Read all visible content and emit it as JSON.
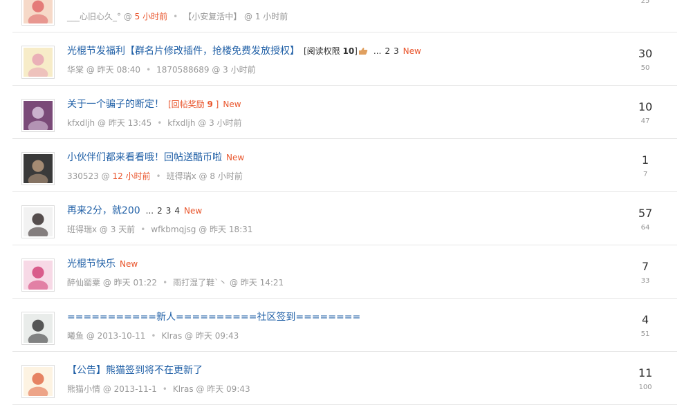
{
  "threads": [
    {
      "title": "",
      "tag": "",
      "tag_num": "",
      "has_thumb": false,
      "pages": [],
      "is_new": false,
      "author": "___心旧心久_°",
      "author_time": "5 小时前",
      "author_time_red": true,
      "last_poster": "【小安复活中】",
      "last_time": "1 小时前",
      "replies": "",
      "views": "25",
      "avatar_colors": [
        "#f6d9c8",
        "#e06a6a"
      ]
    },
    {
      "title": "光棍节发福利【群名片修改插件，抢楼免费发放授权】",
      "tag": "[阅读权限 ",
      "tag_num": "10",
      "tag_end": "]",
      "tag_dark": true,
      "has_thumb": true,
      "pages": [
        "2",
        "3"
      ],
      "is_new": true,
      "author": "华棠",
      "author_time": "昨天 08:40",
      "author_time_red": false,
      "last_poster": "1870588689",
      "last_time": "3 小时前",
      "replies": "30",
      "views": "50",
      "avatar_colors": [
        "#f7ecc8",
        "#e8a6b4"
      ]
    },
    {
      "title": "关于一个骗子的断定！",
      "tag": "[回帖奖励 ",
      "tag_num": "9",
      "tag_end": " ]",
      "tag_dark": false,
      "has_thumb": false,
      "pages": [],
      "is_new": true,
      "author": "kfxdljh",
      "author_time": "昨天 13:45",
      "author_time_red": false,
      "last_poster": "kfxdljh",
      "last_time": "3 小时前",
      "replies": "10",
      "views": "47",
      "avatar_colors": [
        "#7a4a78",
        "#d8c4dc"
      ]
    },
    {
      "title": "小伙伴们都来看看哦！回帖送酷币啦",
      "tag": "",
      "tag_num": "",
      "has_thumb": false,
      "pages": [],
      "is_new": true,
      "author": "330523",
      "author_time": "12 小时前",
      "author_time_red": true,
      "last_poster": "班得瑞x",
      "last_time": "8 小时前",
      "replies": "1",
      "views": "7",
      "avatar_colors": [
        "#3a3a3a",
        "#b89a7e"
      ]
    },
    {
      "title": "再来2分，就200",
      "tag": "",
      "tag_num": "",
      "has_thumb": false,
      "pages": [
        "2",
        "3",
        "4"
      ],
      "is_new": true,
      "author": "班得瑞x",
      "author_time": "3 天前",
      "author_time_red": false,
      "last_poster": "wfkbmqjsg",
      "last_time": "昨天 18:31",
      "replies": "57",
      "views": "64",
      "avatar_colors": [
        "#f2f2f2",
        "#3a3030"
      ]
    },
    {
      "title": "光棍节快乐",
      "tag": "",
      "tag_num": "",
      "has_thumb": false,
      "pages": [],
      "is_new": true,
      "author": "醉仙罂粟",
      "author_time": "昨天 01:22",
      "author_time_red": false,
      "last_poster": "雨打湿了鞋`丶",
      "last_time": "昨天 14:21",
      "replies": "7",
      "views": "33",
      "avatar_colors": [
        "#f7d9e6",
        "#d4457a"
      ]
    },
    {
      "title": "===========新人==========社区签到========",
      "tag": "",
      "tag_num": "",
      "has_thumb": false,
      "pages": [],
      "is_new": false,
      "author": "曦鱼",
      "author_time": "2013-10-11",
      "author_time_red": false,
      "last_poster": "Klras",
      "last_time": "昨天 09:43",
      "replies": "4",
      "views": "51",
      "avatar_colors": [
        "#e9ecea",
        "#3c3c3c"
      ]
    },
    {
      "title": "【公告】熊猫签到将不在更新了",
      "tag": "",
      "tag_num": "",
      "has_thumb": false,
      "pages": [],
      "is_new": false,
      "author": "熊猫小情",
      "author_time": "2013-11-1",
      "author_time_red": false,
      "last_poster": "Klras",
      "last_time": "昨天 09:43",
      "replies": "11",
      "views": "100",
      "avatar_colors": [
        "#fdf3e2",
        "#e26f4c"
      ]
    }
  ],
  "labels": {
    "new": "New",
    "ellipsis": "...",
    "at": "@",
    "bullet": "•"
  }
}
